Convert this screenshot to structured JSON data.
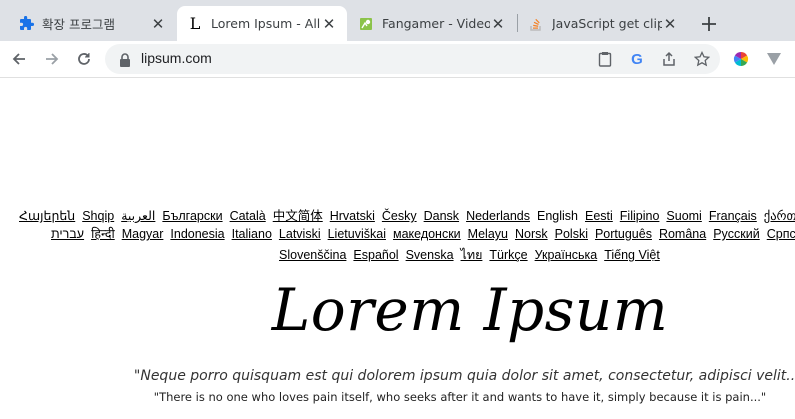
{
  "browser": {
    "tabs": [
      {
        "title": "확장 프로그램",
        "icon": "puzzle-icon"
      },
      {
        "title": "Lorem Ipsum - All the facts",
        "icon": "lipsum-favicon"
      },
      {
        "title": "Fangamer - Video game",
        "icon": "fangamer-favicon"
      },
      {
        "title": "JavaScript get clipboard",
        "icon": "stackoverflow-favicon"
      }
    ],
    "url": "lipsum.com"
  },
  "page": {
    "languages_row1": [
      "Հայերեն",
      "Shqip",
      "العربية",
      "Български",
      "Català",
      "中文简体",
      "Hrvatski",
      "Česky",
      "Dansk",
      "Nederlands",
      "English",
      "Eesti",
      "Filipino",
      "Suomi",
      "Français",
      "ქართული"
    ],
    "languages_row2": [
      "עברית",
      "हिन्दी",
      "Magyar",
      "Indonesia",
      "Italiano",
      "Latviski",
      "Lietuviškai",
      "македонски",
      "Melayu",
      "Norsk",
      "Polski",
      "Português",
      "Româna",
      "Pyccкий",
      "Српски"
    ],
    "languages_row3": [
      "Slovenščina",
      "Español",
      "Svenska",
      "ไทย",
      "Türkçe",
      "Українська",
      "Tiếng Việt"
    ],
    "current_language": "English",
    "logo_text": "Lorem Ipsum",
    "quote": "\"Neque porro quisquam est qui dolorem ipsum quia dolor sit amet, consectetur, adipisci velit...\"",
    "translation": "\"There is no one who loves pain itself, who seeks after it and wants to have it, simply because it is pain...\""
  },
  "colors": {
    "tabstrip": "#dee1e6",
    "accent_blue": "#1a73e8",
    "fangamer_green": "#8bc34a",
    "stackoverflow_orange": "#f48024"
  }
}
